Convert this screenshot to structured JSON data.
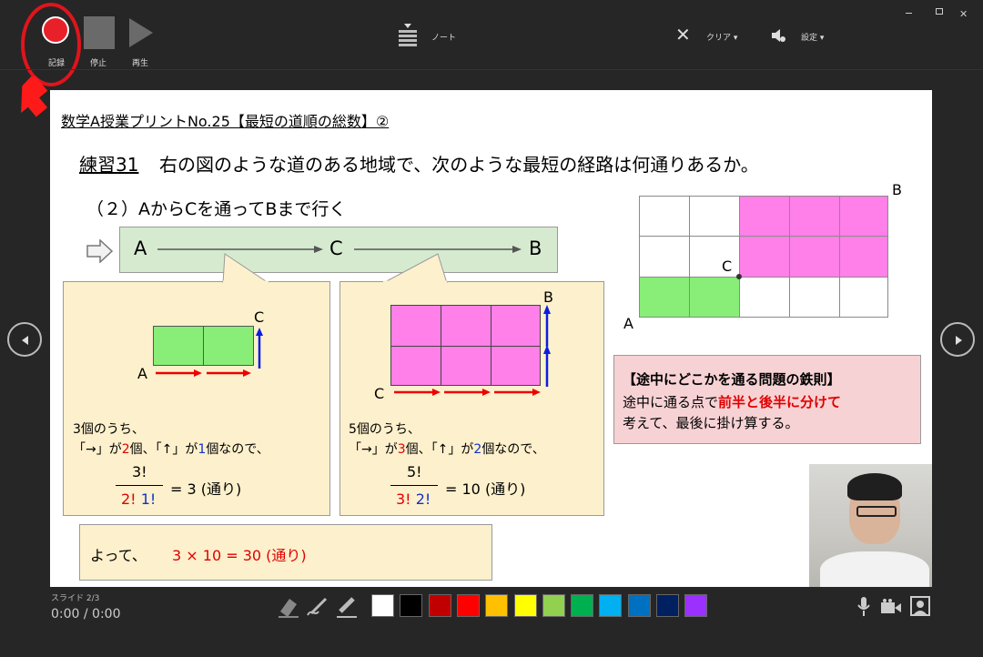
{
  "toolbar": {
    "record_label": "記録",
    "stop_label": "停止",
    "play_label": "再生",
    "notes_label": "ノート",
    "clear_label": "クリア ▾",
    "settings_label": "設定 ▾"
  },
  "slide": {
    "header": "数学A授業プリントNo.25【最短の道順の総数】②",
    "exercise_label": "練習31",
    "exercise_text": "右の図のような道のある地域で、次のような最短の経路は何通りあるか。",
    "subproblem": "（２）AからCを通ってBまで行く",
    "route": {
      "a": "A",
      "c": "C",
      "b": "B"
    },
    "left_box": {
      "top_label": "C",
      "bottom_label": "A",
      "line1": "3個のうち、",
      "line2_pre": "「→」が",
      "line2_n1": "2",
      "line2_mid": "個、「↑」が",
      "line2_n2": "1",
      "line2_post": "個なので、",
      "numerator": "3!",
      "den1": "2!",
      "den2": "1!",
      "result": "= 3 (通り)"
    },
    "right_box": {
      "top_label": "B",
      "bottom_label": "C",
      "line1": "5個のうち、",
      "line2_pre": "「→」が",
      "line2_n1": "3",
      "line2_mid": "個、「↑」が",
      "line2_n2": "2",
      "line2_post": "個なので、",
      "numerator": "5!",
      "den1": "3!",
      "den2": "2!",
      "result": "= 10 (通り)"
    },
    "conclusion_pre": "よって、",
    "conclusion_formula": "3 × 10 = 30 (通り)",
    "grid_labels": {
      "a": "A",
      "b": "B",
      "c": "C"
    },
    "rule": {
      "title": "【途中にどこかを通る問題の鉄則】",
      "line1_pre": "途中に通る点で",
      "line1_highlight": "前半と後半に分けて",
      "line2": "考えて、最後に掛け算する。"
    }
  },
  "status": {
    "slide_counter": "スライド 2/3",
    "time": "0:00 / 0:00"
  },
  "colors": {
    "record": "#e8202a",
    "green": "#88ee77",
    "magenta": "#ff80e8",
    "callout": "#fdf0cc",
    "route_box": "#d6ead0",
    "rule_box": "#f7d2d4"
  },
  "palette": [
    "#ffffff",
    "#000000",
    "#c00000",
    "#ff0000",
    "#ffc000",
    "#ffff00",
    "#92d050",
    "#00b050",
    "#00b0f0",
    "#0070c0",
    "#002060",
    "#9b30ff"
  ]
}
